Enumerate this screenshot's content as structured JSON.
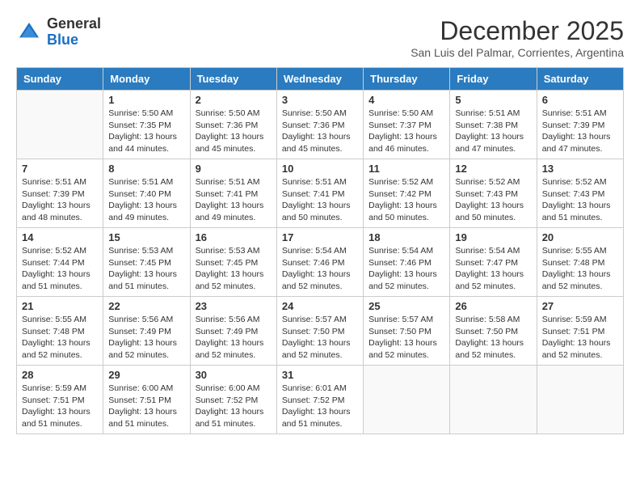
{
  "header": {
    "logo_line1": "General",
    "logo_line2": "Blue",
    "month_year": "December 2025",
    "location": "San Luis del Palmar, Corrientes, Argentina"
  },
  "days_of_week": [
    "Sunday",
    "Monday",
    "Tuesday",
    "Wednesday",
    "Thursday",
    "Friday",
    "Saturday"
  ],
  "weeks": [
    [
      {
        "day": "",
        "info": ""
      },
      {
        "day": "1",
        "info": "Sunrise: 5:50 AM\nSunset: 7:35 PM\nDaylight: 13 hours\nand 44 minutes."
      },
      {
        "day": "2",
        "info": "Sunrise: 5:50 AM\nSunset: 7:36 PM\nDaylight: 13 hours\nand 45 minutes."
      },
      {
        "day": "3",
        "info": "Sunrise: 5:50 AM\nSunset: 7:36 PM\nDaylight: 13 hours\nand 45 minutes."
      },
      {
        "day": "4",
        "info": "Sunrise: 5:50 AM\nSunset: 7:37 PM\nDaylight: 13 hours\nand 46 minutes."
      },
      {
        "day": "5",
        "info": "Sunrise: 5:51 AM\nSunset: 7:38 PM\nDaylight: 13 hours\nand 47 minutes."
      },
      {
        "day": "6",
        "info": "Sunrise: 5:51 AM\nSunset: 7:39 PM\nDaylight: 13 hours\nand 47 minutes."
      }
    ],
    [
      {
        "day": "7",
        "info": "Sunrise: 5:51 AM\nSunset: 7:39 PM\nDaylight: 13 hours\nand 48 minutes."
      },
      {
        "day": "8",
        "info": "Sunrise: 5:51 AM\nSunset: 7:40 PM\nDaylight: 13 hours\nand 49 minutes."
      },
      {
        "day": "9",
        "info": "Sunrise: 5:51 AM\nSunset: 7:41 PM\nDaylight: 13 hours\nand 49 minutes."
      },
      {
        "day": "10",
        "info": "Sunrise: 5:51 AM\nSunset: 7:41 PM\nDaylight: 13 hours\nand 50 minutes."
      },
      {
        "day": "11",
        "info": "Sunrise: 5:52 AM\nSunset: 7:42 PM\nDaylight: 13 hours\nand 50 minutes."
      },
      {
        "day": "12",
        "info": "Sunrise: 5:52 AM\nSunset: 7:43 PM\nDaylight: 13 hours\nand 50 minutes."
      },
      {
        "day": "13",
        "info": "Sunrise: 5:52 AM\nSunset: 7:43 PM\nDaylight: 13 hours\nand 51 minutes."
      }
    ],
    [
      {
        "day": "14",
        "info": "Sunrise: 5:52 AM\nSunset: 7:44 PM\nDaylight: 13 hours\nand 51 minutes."
      },
      {
        "day": "15",
        "info": "Sunrise: 5:53 AM\nSunset: 7:45 PM\nDaylight: 13 hours\nand 51 minutes."
      },
      {
        "day": "16",
        "info": "Sunrise: 5:53 AM\nSunset: 7:45 PM\nDaylight: 13 hours\nand 52 minutes."
      },
      {
        "day": "17",
        "info": "Sunrise: 5:54 AM\nSunset: 7:46 PM\nDaylight: 13 hours\nand 52 minutes."
      },
      {
        "day": "18",
        "info": "Sunrise: 5:54 AM\nSunset: 7:46 PM\nDaylight: 13 hours\nand 52 minutes."
      },
      {
        "day": "19",
        "info": "Sunrise: 5:54 AM\nSunset: 7:47 PM\nDaylight: 13 hours\nand 52 minutes."
      },
      {
        "day": "20",
        "info": "Sunrise: 5:55 AM\nSunset: 7:48 PM\nDaylight: 13 hours\nand 52 minutes."
      }
    ],
    [
      {
        "day": "21",
        "info": "Sunrise: 5:55 AM\nSunset: 7:48 PM\nDaylight: 13 hours\nand 52 minutes."
      },
      {
        "day": "22",
        "info": "Sunrise: 5:56 AM\nSunset: 7:49 PM\nDaylight: 13 hours\nand 52 minutes."
      },
      {
        "day": "23",
        "info": "Sunrise: 5:56 AM\nSunset: 7:49 PM\nDaylight: 13 hours\nand 52 minutes."
      },
      {
        "day": "24",
        "info": "Sunrise: 5:57 AM\nSunset: 7:50 PM\nDaylight: 13 hours\nand 52 minutes."
      },
      {
        "day": "25",
        "info": "Sunrise: 5:57 AM\nSunset: 7:50 PM\nDaylight: 13 hours\nand 52 minutes."
      },
      {
        "day": "26",
        "info": "Sunrise: 5:58 AM\nSunset: 7:50 PM\nDaylight: 13 hours\nand 52 minutes."
      },
      {
        "day": "27",
        "info": "Sunrise: 5:59 AM\nSunset: 7:51 PM\nDaylight: 13 hours\nand 52 minutes."
      }
    ],
    [
      {
        "day": "28",
        "info": "Sunrise: 5:59 AM\nSunset: 7:51 PM\nDaylight: 13 hours\nand 51 minutes."
      },
      {
        "day": "29",
        "info": "Sunrise: 6:00 AM\nSunset: 7:51 PM\nDaylight: 13 hours\nand 51 minutes."
      },
      {
        "day": "30",
        "info": "Sunrise: 6:00 AM\nSunset: 7:52 PM\nDaylight: 13 hours\nand 51 minutes."
      },
      {
        "day": "31",
        "info": "Sunrise: 6:01 AM\nSunset: 7:52 PM\nDaylight: 13 hours\nand 51 minutes."
      },
      {
        "day": "",
        "info": ""
      },
      {
        "day": "",
        "info": ""
      },
      {
        "day": "",
        "info": ""
      }
    ]
  ]
}
